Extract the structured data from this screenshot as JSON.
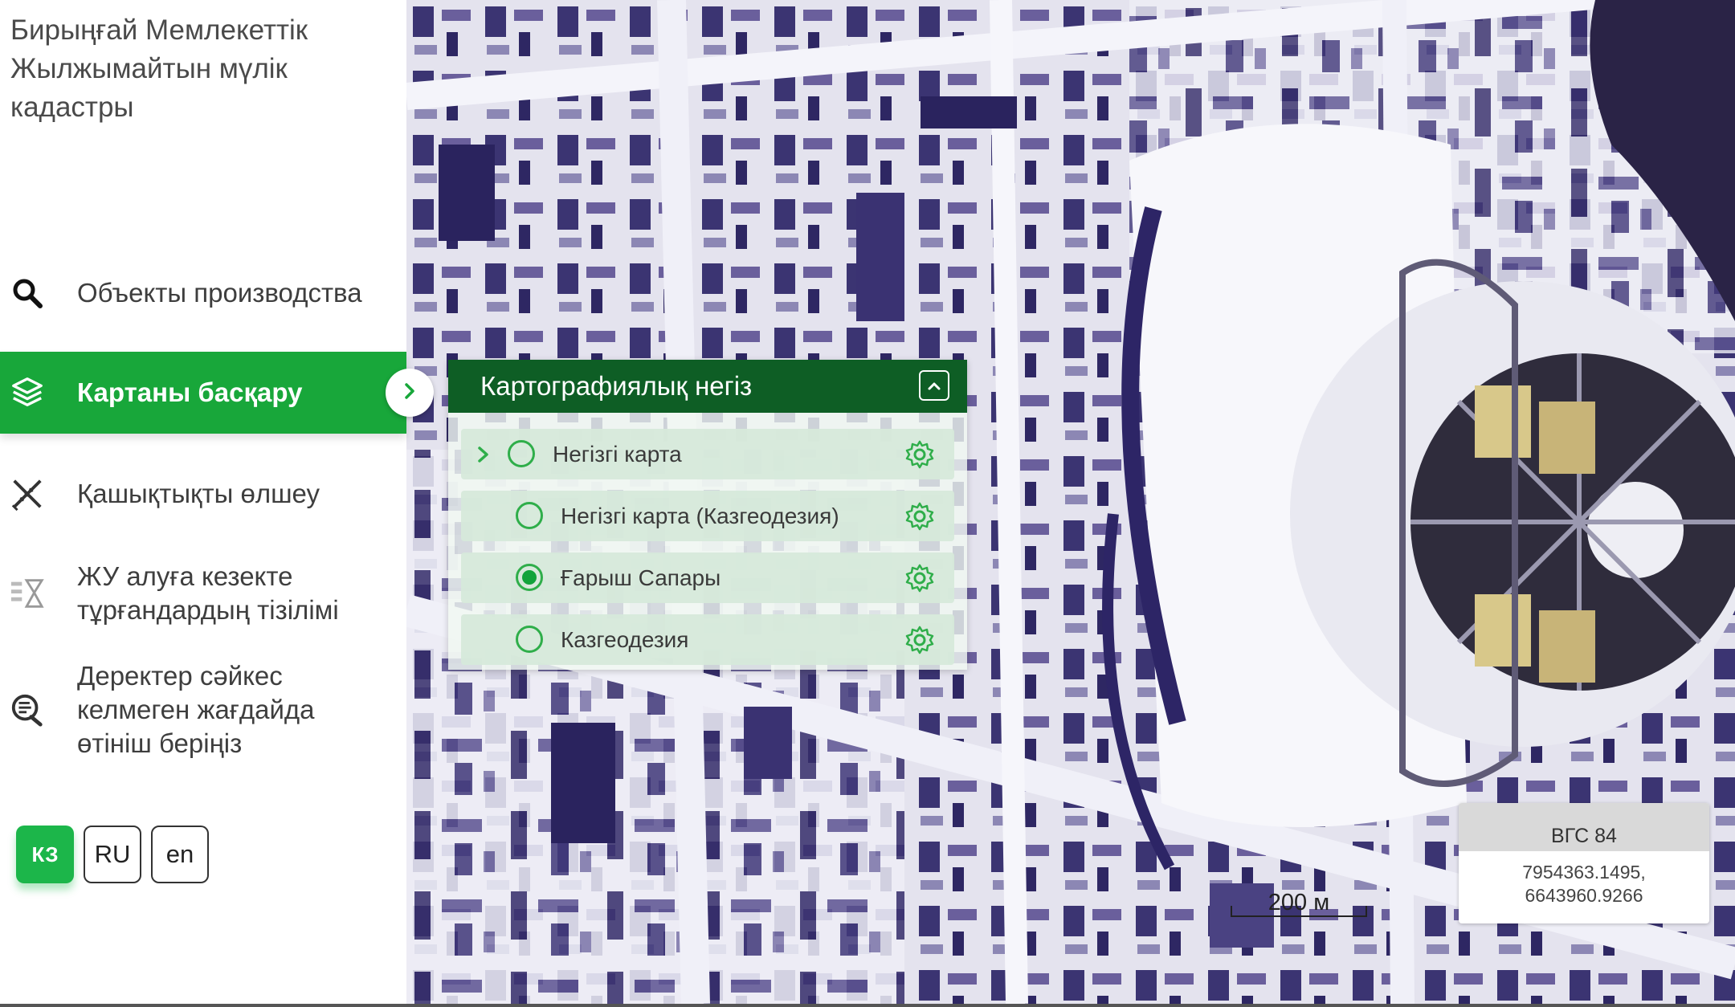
{
  "app": {
    "title": "Бирыңғай Мемлекеттік\nЖылжымайтын мүлік\nкадастры"
  },
  "nav": {
    "items": [
      {
        "label": "Объекты производства",
        "icon": "search-icon"
      },
      {
        "label": "Картаны басқару",
        "icon": "layers-icon",
        "active": true
      },
      {
        "label": "Қашықтықты өлшеу",
        "icon": "ruler-icon"
      },
      {
        "label": "ЖУ алуға кезекте\nтұрғандардың тізілімі",
        "icon": "queue-list-icon"
      },
      {
        "label": "Деректер сәйкес\nкелмеген жағдайда\nөтініш беріңіз",
        "icon": "request-icon"
      }
    ]
  },
  "languages": [
    {
      "label": "КЗ",
      "active": true
    },
    {
      "label": "RU"
    },
    {
      "label": "en"
    }
  ],
  "basemap_panel": {
    "title": "Картографиялық негіз",
    "layers": [
      {
        "label": "Негізгі карта",
        "selected": false,
        "expandable": true
      },
      {
        "label": "Негізгі карта (Казгеодезия)",
        "selected": false
      },
      {
        "label": "Ғарыш Сапары",
        "selected": true
      },
      {
        "label": "Казгеодезия",
        "selected": false
      }
    ]
  },
  "projection": {
    "name": "ВГС 84",
    "coords": "7954363.1495,\n6643960.9266"
  },
  "scale": {
    "label": "200 м"
  },
  "colors": {
    "accent": "#18a73a",
    "panel_header": "#0e5e25",
    "radio": "#2fae4a"
  }
}
